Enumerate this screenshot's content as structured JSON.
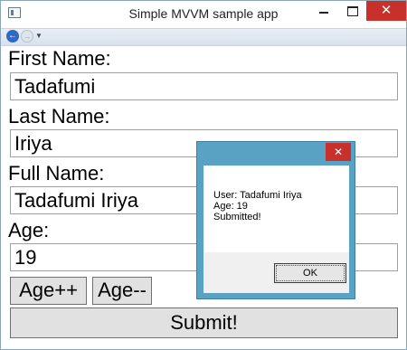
{
  "window": {
    "title": "Simple MVVM sample app",
    "minimize_glyph": "—",
    "maximize_glyph": "□",
    "close_glyph": "✕"
  },
  "nav": {
    "back_glyph": "←",
    "forward_glyph": "→",
    "dropdown_glyph": "▼"
  },
  "form": {
    "first_name_label": "First Name:",
    "first_name_value": "Tadafumi",
    "last_name_label": "Last Name:",
    "last_name_value": "Iriya",
    "full_name_label": "Full Name:",
    "full_name_value": "Tadafumi Iriya",
    "age_label": "Age:",
    "age_value": "19",
    "age_inc_label": "Age++",
    "age_dec_label": "Age--",
    "submit_label": "Submit!"
  },
  "dialog": {
    "close_glyph": "✕",
    "line1": "User: Tadafumi Iriya",
    "line2": "Age: 19",
    "line3": "Submitted!",
    "ok_label": "OK"
  },
  "colors": {
    "close_red": "#c7302b",
    "dialog_frame": "#5aa2c4",
    "nav_blue": "#2f6ac5"
  }
}
